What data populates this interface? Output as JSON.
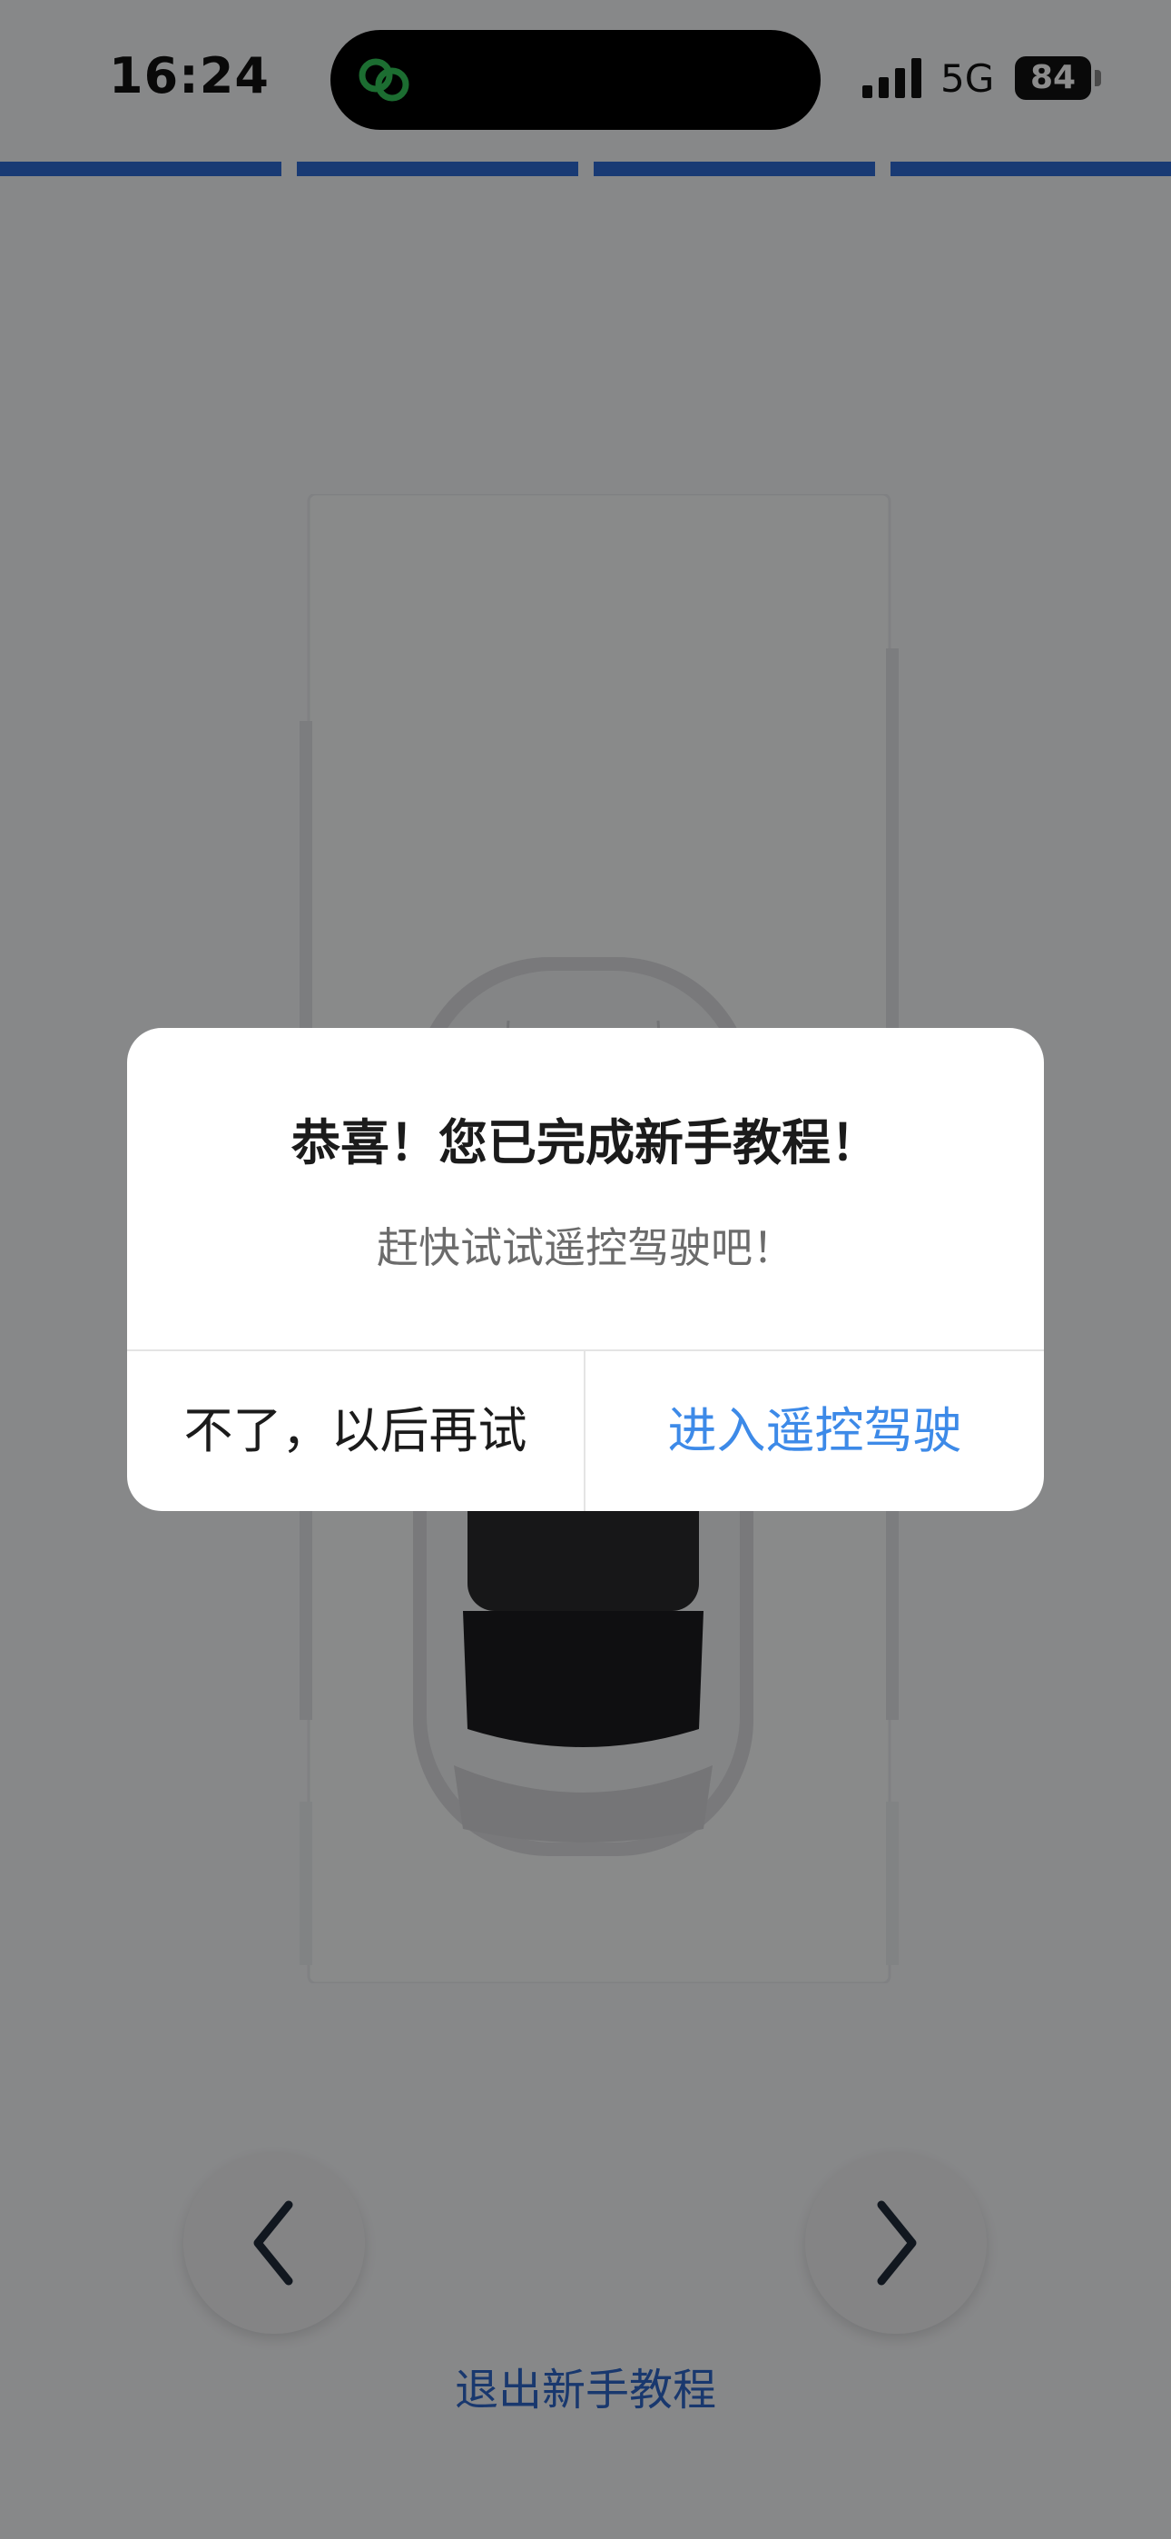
{
  "status_bar": {
    "time": "16:24",
    "network": "5G",
    "battery": "84",
    "icons": [
      "app-activity-icon",
      "signal-icon",
      "battery-icon"
    ]
  },
  "tutorial": {
    "steps_total": 4,
    "steps_completed": 4,
    "accent_color": "#2f6bd3"
  },
  "navigation": {
    "prev_icon": "chevron-left-icon",
    "next_icon": "chevron-right-icon",
    "exit_label": "退出新手教程"
  },
  "dialog": {
    "title": "恭喜！您已完成新手教程！",
    "message": "赶快试试遥控驾驶吧！",
    "cancel_label": "不了，以后再试",
    "confirm_label": "进入遥控驾驶",
    "confirm_color": "#3d8ae8"
  }
}
